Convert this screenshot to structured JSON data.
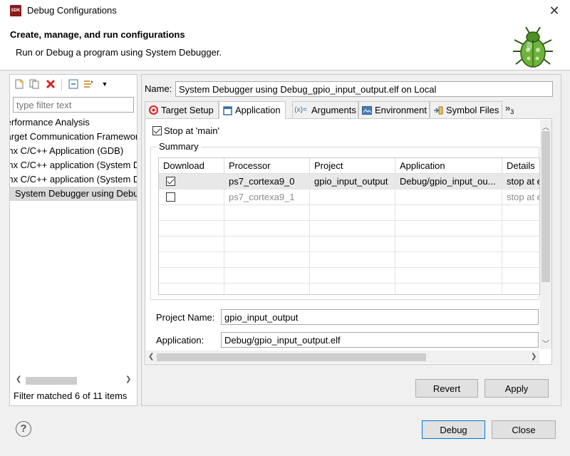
{
  "window": {
    "title": "Debug Configurations",
    "app_icon": "SDK",
    "close": "✕"
  },
  "header": {
    "title": "Create, manage, and run configurations",
    "subtitle": "Run or Debug a program using System Debugger."
  },
  "left_pane": {
    "filter_placeholder": "type filter text",
    "tree_items": [
      "Performance Analysis",
      "Target Communication Framework",
      "Xilinx C/C++ Application (GDB)",
      "Xilinx C/C++ application (System Debugger)",
      "Xilinx C/C++ application (System Debugger on QEMU)",
      "System Debugger using Debug_gpio_input_output.elf on Local"
    ],
    "status": "Filter matched 6 of 11 items"
  },
  "config": {
    "name_label": "Name:",
    "name_value": "System Debugger using Debug_gpio_input_output.elf on Local",
    "tabs": [
      {
        "label": "Target Setup",
        "icon": "target-icon"
      },
      {
        "label": "Application",
        "icon": "application-icon"
      },
      {
        "label": "Arguments",
        "icon": "arguments-icon"
      },
      {
        "label": "Environment",
        "icon": "environment-icon"
      },
      {
        "label": "Symbol Files",
        "icon": "symbol-files-icon"
      }
    ],
    "tab_overflow": "»",
    "tab_overflow_count": "3",
    "stop_at_main_label": "Stop at 'main'",
    "stop_at_main_checked": true,
    "summary_label": "Summary",
    "table": {
      "headers": [
        "Download",
        "Processor",
        "Project",
        "Application",
        "Details"
      ],
      "rows": [
        {
          "download": true,
          "processor": "ps7_cortexa9_0",
          "project": "gpio_input_output",
          "application": "Debug/gpio_input_ou...",
          "details": "stop at e"
        },
        {
          "download": false,
          "processor": "ps7_cortexa9_1",
          "project": "",
          "application": "",
          "details": "stop at e"
        }
      ]
    },
    "project_name_label": "Project Name:",
    "project_name_value": "gpio_input_output",
    "application_label": "Application:",
    "application_value": "Debug/gpio_input_output.elf"
  },
  "buttons": {
    "revert": "Revert",
    "apply": "Apply",
    "debug": "Debug",
    "close": "Close",
    "help": "?"
  }
}
